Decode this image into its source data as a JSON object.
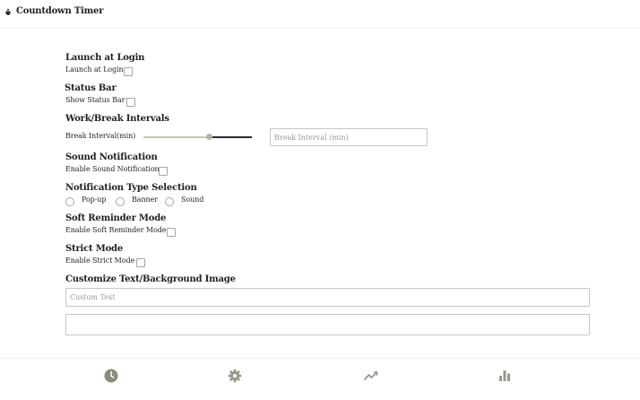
{
  "app": {
    "title": "Countdown Timer",
    "icon": "timer-icon"
  },
  "settings": {
    "launch_at_login": {
      "title": "Launch at Login",
      "label": "Launch at Login",
      "checked": false
    },
    "status_bar": {
      "title": "Status Bar",
      "label": "Show Status Bar",
      "checked": false
    },
    "work_break_intervals": {
      "title": "Work/Break Intervals",
      "label": "Break Interval(min)",
      "slider_value_fraction": 0.6,
      "input_placeholder": "Break Interval (min)",
      "input_value": ""
    },
    "sound_notification": {
      "title": "Sound Notification",
      "label": "Enable Sound Notification",
      "checked": false
    },
    "notification_type": {
      "title": "Notification Type Selection",
      "options": [
        "Pop-up",
        "Banner",
        "Sound"
      ],
      "selected": null
    },
    "soft_reminder": {
      "title": "Soft Reminder Mode",
      "label": "Enable Soft Reminder Mode",
      "checked": false
    },
    "strict_mode": {
      "title": "Strict Mode",
      "label": "Enable Strict Mode",
      "checked": false
    },
    "customize": {
      "title": "Customize Text/Background Image",
      "text_placeholder": "Custom Text",
      "text_value": "",
      "image_value": ""
    }
  },
  "nav": {
    "items": [
      {
        "name": "timer",
        "icon": "clock-icon"
      },
      {
        "name": "settings",
        "icon": "gear-icon"
      },
      {
        "name": "trends",
        "icon": "trend-line-icon"
      },
      {
        "name": "statistics",
        "icon": "bar-chart-icon"
      }
    ],
    "colors": {
      "active": "#8e8a7a",
      "inactive": "#9b978a"
    }
  },
  "colors": {
    "accent": "#b7b19f",
    "slider_fill": "#2b2b2b",
    "border": "#c7c7c7"
  }
}
